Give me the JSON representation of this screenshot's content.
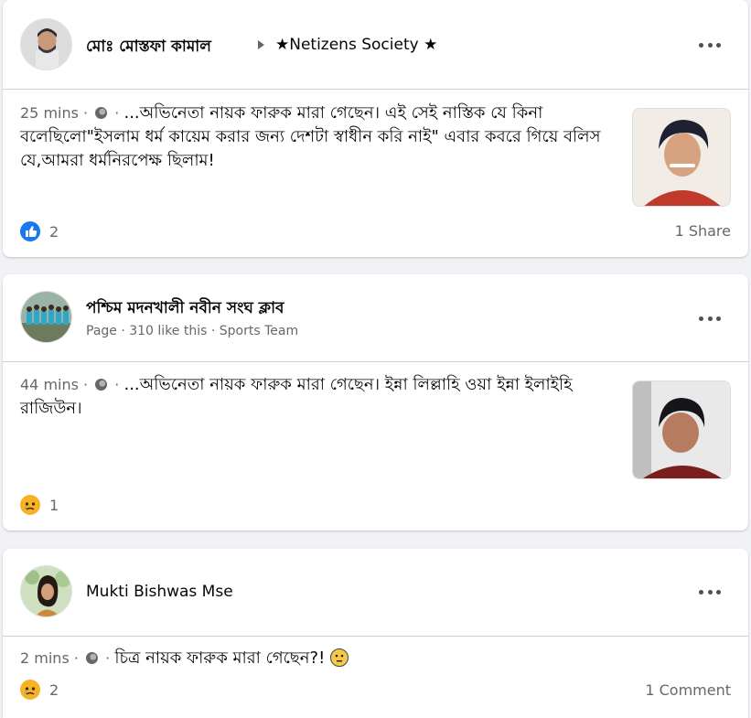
{
  "posts": [
    {
      "author": "মোঃ মোস্তফা কামাল",
      "group": "★Netizens Society ★",
      "time": "25 mins",
      "text": "...অভিনেতা নায়ক ফারুক মারা গেছেন। এই সেই নাস্তিক যে কিনা বলেছিলো\"ইসলাম ধর্ম কায়েম করার জন্য দেশটা স্বাধীন করি নাই\" এবার কবরে গিয়ে বলিস যে,আমরা ধর্মনিরপেক্ষ ছিলাম!",
      "reaction_icon": "like-icon",
      "reaction_count": "2",
      "footer_right": "1 Share"
    },
    {
      "author": "পশ্চিম মদনখালী নবীন সংঘ ক্লাব",
      "subtitle": "Page · 310 like this · Sports Team",
      "time": "44 mins",
      "text": "...অভিনেতা নায়ক ফারুক মারা গেছেন। ইন্না লিল্লাহি ওয়া ইন্না ইলাইহি রাজিউন।",
      "reaction_icon": "sad-icon",
      "reaction_count": "1"
    },
    {
      "author": "Mukti Bishwas Mse",
      "time": "2 mins",
      "text": "চিত্র নায়ক ফারুক মারা গেছেন?!",
      "reaction_icon": "sad-icon",
      "reaction_count": "2",
      "footer_right": "1 Comment"
    }
  ],
  "meta_separator": " · ",
  "colors": {
    "background": "#f0f2f5",
    "card": "#ffffff",
    "secondary_text": "#65676b",
    "like_blue": "#1877f2",
    "sad_yellow": "#f7b125"
  }
}
